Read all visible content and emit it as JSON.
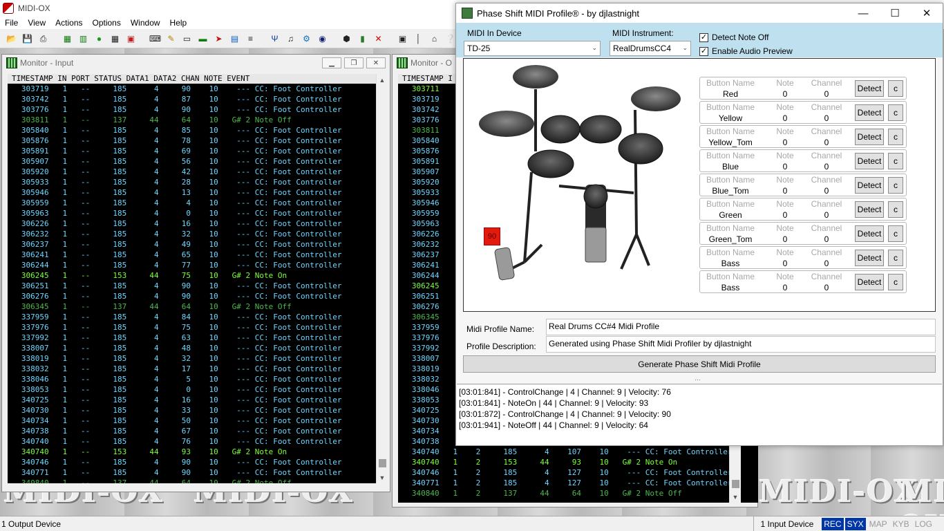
{
  "midiox": {
    "title": "MIDI-OX",
    "menu": [
      "File",
      "View",
      "Actions",
      "Options",
      "Window",
      "Help"
    ],
    "bg_logo": "MIDI-OX",
    "toolbar_icons": [
      "open-icon",
      "save-icon",
      "print-icon",
      "port-icon",
      "mapping-icon",
      "green-circle-icon",
      "grid-icon",
      "sysex-icon",
      "keyboard-icon",
      "sweep-icon",
      "strip-icon",
      "pipe-icon",
      "control-icon",
      "monitor-icon",
      "piano-icon",
      "filter-icon",
      "route-icon",
      "gear-icon",
      "globe-icon",
      "lock-icon",
      "battery-icon",
      "close-icon",
      "window-icon",
      "bar-icon",
      "home-icon",
      "help-icon"
    ]
  },
  "status": {
    "output": "1 Output Device",
    "input": "1 Input Device",
    "indicators": [
      {
        "label": "REC",
        "on": true
      },
      {
        "label": "SYX",
        "on": true
      },
      {
        "label": "MAP",
        "on": false
      },
      {
        "label": "KYB",
        "on": false
      },
      {
        "label": "LOG",
        "on": false
      }
    ]
  },
  "monitor_input": {
    "title": "Monitor - Input",
    "header": "TIMESTAMP IN PORT STATUS DATA1 DATA2 CHAN NOTE EVENT",
    "rows": [
      {
        "ts": "303719",
        "in": "1",
        "port": "--",
        "status": "185",
        "d1": "4",
        "d2": "90",
        "chan": "10",
        "note": "---",
        "event": "CC: Foot Controller",
        "kind": "cc"
      },
      {
        "ts": "303742",
        "in": "1",
        "port": "--",
        "status": "185",
        "d1": "4",
        "d2": "87",
        "chan": "10",
        "note": "---",
        "event": "CC: Foot Controller",
        "kind": "cc"
      },
      {
        "ts": "303776",
        "in": "1",
        "port": "--",
        "status": "185",
        "d1": "4",
        "d2": "90",
        "chan": "10",
        "note": "---",
        "event": "CC: Foot Controller",
        "kind": "cc"
      },
      {
        "ts": "303811",
        "in": "1",
        "port": "--",
        "status": "137",
        "d1": "44",
        "d2": "64",
        "chan": "10",
        "note": "G# 2",
        "event": "Note Off",
        "kind": "off"
      },
      {
        "ts": "305840",
        "in": "1",
        "port": "--",
        "status": "185",
        "d1": "4",
        "d2": "85",
        "chan": "10",
        "note": "---",
        "event": "CC: Foot Controller",
        "kind": "cc"
      },
      {
        "ts": "305876",
        "in": "1",
        "port": "--",
        "status": "185",
        "d1": "4",
        "d2": "78",
        "chan": "10",
        "note": "---",
        "event": "CC: Foot Controller",
        "kind": "cc"
      },
      {
        "ts": "305891",
        "in": "1",
        "port": "--",
        "status": "185",
        "d1": "4",
        "d2": "69",
        "chan": "10",
        "note": "---",
        "event": "CC: Foot Controller",
        "kind": "cc"
      },
      {
        "ts": "305907",
        "in": "1",
        "port": "--",
        "status": "185",
        "d1": "4",
        "d2": "56",
        "chan": "10",
        "note": "---",
        "event": "CC: Foot Controller",
        "kind": "cc"
      },
      {
        "ts": "305920",
        "in": "1",
        "port": "--",
        "status": "185",
        "d1": "4",
        "d2": "42",
        "chan": "10",
        "note": "---",
        "event": "CC: Foot Controller",
        "kind": "cc"
      },
      {
        "ts": "305933",
        "in": "1",
        "port": "--",
        "status": "185",
        "d1": "4",
        "d2": "28",
        "chan": "10",
        "note": "---",
        "event": "CC: Foot Controller",
        "kind": "cc"
      },
      {
        "ts": "305946",
        "in": "1",
        "port": "--",
        "status": "185",
        "d1": "4",
        "d2": "13",
        "chan": "10",
        "note": "---",
        "event": "CC: Foot Controller",
        "kind": "cc"
      },
      {
        "ts": "305959",
        "in": "1",
        "port": "--",
        "status": "185",
        "d1": "4",
        "d2": "4",
        "chan": "10",
        "note": "---",
        "event": "CC: Foot Controller",
        "kind": "cc"
      },
      {
        "ts": "305963",
        "in": "1",
        "port": "--",
        "status": "185",
        "d1": "4",
        "d2": "0",
        "chan": "10",
        "note": "---",
        "event": "CC: Foot Controller",
        "kind": "cc"
      },
      {
        "ts": "306226",
        "in": "1",
        "port": "--",
        "status": "185",
        "d1": "4",
        "d2": "16",
        "chan": "10",
        "note": "---",
        "event": "CC: Foot Controller",
        "kind": "cc"
      },
      {
        "ts": "306232",
        "in": "1",
        "port": "--",
        "status": "185",
        "d1": "4",
        "d2": "32",
        "chan": "10",
        "note": "---",
        "event": "CC: Foot Controller",
        "kind": "cc"
      },
      {
        "ts": "306237",
        "in": "1",
        "port": "--",
        "status": "185",
        "d1": "4",
        "d2": "49",
        "chan": "10",
        "note": "---",
        "event": "CC: Foot Controller",
        "kind": "cc"
      },
      {
        "ts": "306241",
        "in": "1",
        "port": "--",
        "status": "185",
        "d1": "4",
        "d2": "65",
        "chan": "10",
        "note": "---",
        "event": "CC: Foot Controller",
        "kind": "cc"
      },
      {
        "ts": "306244",
        "in": "1",
        "port": "--",
        "status": "185",
        "d1": "4",
        "d2": "77",
        "chan": "10",
        "note": "---",
        "event": "CC: Foot Controller",
        "kind": "cc"
      },
      {
        "ts": "306245",
        "in": "1",
        "port": "--",
        "status": "153",
        "d1": "44",
        "d2": "75",
        "chan": "10",
        "note": "G# 2",
        "event": "Note On",
        "kind": "on"
      },
      {
        "ts": "306251",
        "in": "1",
        "port": "--",
        "status": "185",
        "d1": "4",
        "d2": "90",
        "chan": "10",
        "note": "---",
        "event": "CC: Foot Controller",
        "kind": "cc"
      },
      {
        "ts": "306276",
        "in": "1",
        "port": "--",
        "status": "185",
        "d1": "4",
        "d2": "90",
        "chan": "10",
        "note": "---",
        "event": "CC: Foot Controller",
        "kind": "cc"
      },
      {
        "ts": "306345",
        "in": "1",
        "port": "--",
        "status": "137",
        "d1": "44",
        "d2": "64",
        "chan": "10",
        "note": "G# 2",
        "event": "Note Off",
        "kind": "off"
      },
      {
        "ts": "337959",
        "in": "1",
        "port": "--",
        "status": "185",
        "d1": "4",
        "d2": "84",
        "chan": "10",
        "note": "---",
        "event": "CC: Foot Controller",
        "kind": "cc"
      },
      {
        "ts": "337976",
        "in": "1",
        "port": "--",
        "status": "185",
        "d1": "4",
        "d2": "75",
        "chan": "10",
        "note": "---",
        "event": "CC: Foot Controller",
        "kind": "cc"
      },
      {
        "ts": "337992",
        "in": "1",
        "port": "--",
        "status": "185",
        "d1": "4",
        "d2": "63",
        "chan": "10",
        "note": "---",
        "event": "CC: Foot Controller",
        "kind": "cc"
      },
      {
        "ts": "338007",
        "in": "1",
        "port": "--",
        "status": "185",
        "d1": "4",
        "d2": "48",
        "chan": "10",
        "note": "---",
        "event": "CC: Foot Controller",
        "kind": "cc"
      },
      {
        "ts": "338019",
        "in": "1",
        "port": "--",
        "status": "185",
        "d1": "4",
        "d2": "32",
        "chan": "10",
        "note": "---",
        "event": "CC: Foot Controller",
        "kind": "cc"
      },
      {
        "ts": "338032",
        "in": "1",
        "port": "--",
        "status": "185",
        "d1": "4",
        "d2": "17",
        "chan": "10",
        "note": "---",
        "event": "CC: Foot Controller",
        "kind": "cc"
      },
      {
        "ts": "338046",
        "in": "1",
        "port": "--",
        "status": "185",
        "d1": "4",
        "d2": "5",
        "chan": "10",
        "note": "---",
        "event": "CC: Foot Controller",
        "kind": "cc"
      },
      {
        "ts": "338053",
        "in": "1",
        "port": "--",
        "status": "185",
        "d1": "4",
        "d2": "0",
        "chan": "10",
        "note": "---",
        "event": "CC: Foot Controller",
        "kind": "cc"
      },
      {
        "ts": "340725",
        "in": "1",
        "port": "--",
        "status": "185",
        "d1": "4",
        "d2": "16",
        "chan": "10",
        "note": "---",
        "event": "CC: Foot Controller",
        "kind": "cc"
      },
      {
        "ts": "340730",
        "in": "1",
        "port": "--",
        "status": "185",
        "d1": "4",
        "d2": "33",
        "chan": "10",
        "note": "---",
        "event": "CC: Foot Controller",
        "kind": "cc"
      },
      {
        "ts": "340734",
        "in": "1",
        "port": "--",
        "status": "185",
        "d1": "4",
        "d2": "50",
        "chan": "10",
        "note": "---",
        "event": "CC: Foot Controller",
        "kind": "cc"
      },
      {
        "ts": "340738",
        "in": "1",
        "port": "--",
        "status": "185",
        "d1": "4",
        "d2": "67",
        "chan": "10",
        "note": "---",
        "event": "CC: Foot Controller",
        "kind": "cc"
      },
      {
        "ts": "340740",
        "in": "1",
        "port": "--",
        "status": "185",
        "d1": "4",
        "d2": "76",
        "chan": "10",
        "note": "---",
        "event": "CC: Foot Controller",
        "kind": "cc"
      },
      {
        "ts": "340740",
        "in": "1",
        "port": "--",
        "status": "153",
        "d1": "44",
        "d2": "93",
        "chan": "10",
        "note": "G# 2",
        "event": "Note On",
        "kind": "on"
      },
      {
        "ts": "340746",
        "in": "1",
        "port": "--",
        "status": "185",
        "d1": "4",
        "d2": "90",
        "chan": "10",
        "note": "---",
        "event": "CC: Foot Controller",
        "kind": "cc"
      },
      {
        "ts": "340771",
        "in": "1",
        "port": "--",
        "status": "185",
        "d1": "4",
        "d2": "90",
        "chan": "10",
        "note": "---",
        "event": "CC: Foot Controller",
        "kind": "cc"
      },
      {
        "ts": "340840",
        "in": "1",
        "port": "--",
        "status": "137",
        "d1": "44",
        "d2": "64",
        "chan": "10",
        "note": "G# 2",
        "event": "Note Off",
        "kind": "off"
      }
    ]
  },
  "monitor_output": {
    "title": "Monitor - O",
    "header": "TIMESTAMP I",
    "hidden_rows_ts": [
      "303711",
      "303719",
      "303742",
      "303776",
      "303811",
      "305840",
      "305876",
      "305891",
      "305907",
      "305920",
      "305933",
      "305946",
      "305959",
      "305963",
      "306226",
      "306232",
      "306237",
      "306241",
      "306244",
      "306245",
      "306251",
      "306276",
      "306345",
      "337959",
      "337976",
      "337992",
      "338007",
      "338019",
      "338032",
      "338046",
      "338053",
      "340725",
      "340730",
      "340734",
      "340738"
    ],
    "hidden_rows_kind": [
      "on",
      "cc",
      "cc",
      "cc",
      "off",
      "cc",
      "cc",
      "cc",
      "cc",
      "cc",
      "cc",
      "cc",
      "cc",
      "cc",
      "cc",
      "cc",
      "cc",
      "cc",
      "cc",
      "on",
      "cc",
      "cc",
      "off",
      "cc",
      "cc",
      "cc",
      "cc",
      "cc",
      "cc",
      "cc",
      "cc",
      "cc",
      "cc",
      "cc",
      "cc"
    ],
    "full_rows": [
      {
        "ts": "340740",
        "in": "1",
        "port": "2",
        "status": "185",
        "d1": "4",
        "d2": "107",
        "chan": "10",
        "note": "---",
        "event": "CC: Foot Controller",
        "kind": "cc"
      },
      {
        "ts": "340740",
        "in": "1",
        "port": "2",
        "status": "153",
        "d1": "44",
        "d2": "93",
        "chan": "10",
        "note": "G# 2",
        "event": "Note On",
        "kind": "on"
      },
      {
        "ts": "340746",
        "in": "1",
        "port": "2",
        "status": "185",
        "d1": "4",
        "d2": "127",
        "chan": "10",
        "note": "---",
        "event": "CC: Foot Controller",
        "kind": "cc"
      },
      {
        "ts": "340771",
        "in": "1",
        "port": "2",
        "status": "185",
        "d1": "4",
        "d2": "127",
        "chan": "10",
        "note": "---",
        "event": "CC: Foot Controller",
        "kind": "cc"
      },
      {
        "ts": "340840",
        "in": "1",
        "port": "2",
        "status": "137",
        "d1": "44",
        "d2": "64",
        "chan": "10",
        "note": "G# 2",
        "event": "Note Off",
        "kind": "off"
      }
    ]
  },
  "phase_shift": {
    "title": "Phase Shift MIDI Profile® - by djlastnight",
    "midi_in_label": "MIDI In Device",
    "midi_in_value": "TD-25",
    "midi_instrument_label": "MIDI Instrument:",
    "midi_instrument_value": "RealDrumsCC4",
    "detect_note_off_label": "Detect Note Off",
    "detect_note_off": true,
    "enable_audio_preview_label": "Enable Audio Preview",
    "enable_audio_preview": true,
    "velocity_badge": "90",
    "col_button_name": "Button Name",
    "col_note": "Note",
    "col_channel": "Channel",
    "detect_label": "Detect",
    "clear_label": "c",
    "pads": [
      {
        "name": "Red",
        "note": "0",
        "channel": "0"
      },
      {
        "name": "Yellow",
        "note": "0",
        "channel": "0"
      },
      {
        "name": "Yellow_Tom",
        "note": "0",
        "channel": "0"
      },
      {
        "name": "Blue",
        "note": "0",
        "channel": "0"
      },
      {
        "name": "Blue_Tom",
        "note": "0",
        "channel": "0"
      },
      {
        "name": "Green",
        "note": "0",
        "channel": "0"
      },
      {
        "name": "Green_Tom",
        "note": "0",
        "channel": "0"
      },
      {
        "name": "Bass",
        "note": "0",
        "channel": "0"
      },
      {
        "name": "Bass",
        "note": "0",
        "channel": "0"
      }
    ],
    "profile_name_label": "Midi Profile Name:",
    "profile_name_value": "Real Drums CC#4 Midi Profile",
    "profile_desc_label": "Profile Description:",
    "profile_desc_value": "Generated using Phase Shift Midi Profiler by djlastnight",
    "generate_label": "Generate Phase Shift Midi Profile",
    "log": [
      "[03:01:841] - ControlChange | 4 | Channel: 9 | Velocity: 76",
      "[03:01:841] - NoteOn | 44 | Channel: 9 | Velocity: 93",
      "[03:01:872] - ControlChange | 4 | Channel: 9 | Velocity: 90",
      "[03:01:941] - NoteOff | 44 | Channel: 9 | Velocity: 64"
    ]
  },
  "colors": {
    "cc": "#6fd6ff",
    "note_on": "#7cff3a",
    "note_off": "#4cb84c",
    "indicator_on": "#0036a8",
    "velocity_badge": "#e31b0e",
    "ps_header_bg": "#bfe0ef"
  }
}
